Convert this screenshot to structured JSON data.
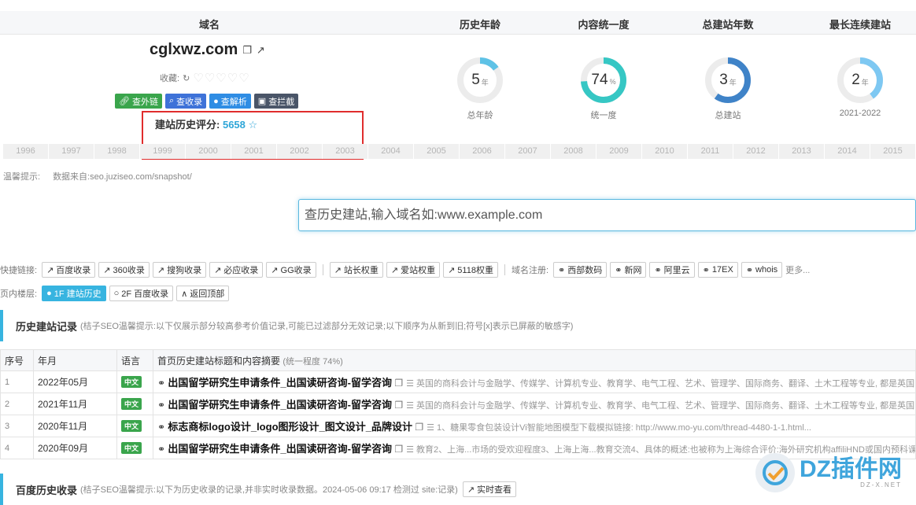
{
  "header": {
    "domain_col": "域名",
    "age_col": "历史年龄",
    "consistency_col": "内容统一度",
    "years_col": "总建站年数",
    "streak_col": "最长连续建站"
  },
  "domain": {
    "name": "cglxwz.com",
    "copy_icon": "copy-icon",
    "open_icon": "external-link-icon",
    "fav_label": "收藏:",
    "refresh_icon": "refresh-icon",
    "hearts": "♡♡♡♡♡"
  },
  "actions": [
    {
      "label": "查外链",
      "icon": "link-icon",
      "color": "#3aa54c"
    },
    {
      "label": "查收录",
      "icon": "search-icon",
      "color": "#3e72d8"
    },
    {
      "label": "查解析",
      "icon": "location-icon",
      "color": "#2f8de4"
    },
    {
      "label": "查拦截",
      "icon": "lock-icon",
      "color": "#4a5568"
    }
  ],
  "score": {
    "label": "建站历史评分:",
    "value": "5658",
    "star": "☆"
  },
  "stats": [
    {
      "value": "5",
      "unit": "年",
      "label": "总年龄",
      "fraction": 0.15,
      "color": "#5ec2e6"
    },
    {
      "value": "74",
      "unit": "%",
      "label": "统一度",
      "fraction": 0.74,
      "color": "#36c7c4"
    },
    {
      "value": "3",
      "unit": "年",
      "label": "总建站",
      "fraction": 0.6,
      "color": "#3f83c8"
    },
    {
      "value": "2",
      "unit": "年",
      "label": "2021-2022",
      "fraction": 0.4,
      "color": "#7ec8f2"
    }
  ],
  "timeline": [
    "1996",
    "1997",
    "1998",
    "1999",
    "2000",
    "2001",
    "2002",
    "2003",
    "2004",
    "2005",
    "2006",
    "2007",
    "2008",
    "2009",
    "2010",
    "2011",
    "2012",
    "2013",
    "2014",
    "2015"
  ],
  "tip": {
    "label": "温馨提示:",
    "source": "数据来自:seo.juziseo.com/snapshot/"
  },
  "search": {
    "placeholder": "查历史建站,输入域名如:www.example.com"
  },
  "quick_links": {
    "label": "快捷链接:",
    "group1": [
      "百度收录",
      "360收录",
      "搜狗收录",
      "必应收录",
      "GG收录"
    ],
    "group2": [
      "站长权重",
      "爱站权重",
      "5118权重"
    ],
    "register_label": "域名注册:",
    "group3": [
      "西部数码",
      "新网",
      "阿里云",
      "17EX",
      "whois"
    ],
    "more": "更多..."
  },
  "floors": {
    "label": "页内楼层:",
    "items": [
      "1F 建站历史",
      "2F 百度收录",
      "返回顶部"
    ]
  },
  "history": {
    "title": "历史建站记录",
    "desc": "(桔子SEO温馨提示:以下仅展示部分较高参考价值记录,可能已过滤部分无效记录;以下顺序为从新到旧;符号[x]表示已屏蔽的敏感字)",
    "cols": {
      "idx": "序号",
      "date": "年月",
      "lang": "语言",
      "title": "首页历史建站标题和内容摘要",
      "title_note": "(统一程度 74%)"
    },
    "rows": [
      {
        "idx": "1",
        "date": "2022年05月",
        "lang": "中文",
        "title": "出国留学研究生申请条件_出国读研咨询-留学咨询",
        "desc": "英国的商科会计与金融学、传媒学、计算机专业、教育学、电气工程、艺术、管理学、国际商务、翻译、土木工程等专业, 都是英国的强"
      },
      {
        "idx": "2",
        "date": "2021年11月",
        "lang": "中文",
        "title": "出国留学研究生申请条件_出国读研咨询-留学咨询",
        "desc": "英国的商科会计与金融学、传媒学、计算机专业、教育学、电气工程、艺术、管理学、国际商务、翻译、土木工程等专业, 都是英国的强"
      },
      {
        "idx": "3",
        "date": "2020年11月",
        "lang": "中文",
        "title": "标志商标logo设计_logo图形设计_图文设计_品牌设计",
        "desc": "1、糖果零食包装设计Vi智能地图模型下载模拟链接: http://www.mo-yu.com/thread-4480-1-1.html..."
      },
      {
        "idx": "4",
        "date": "2020年09月",
        "lang": "中文",
        "title": "出国留学研究生申请条件_出国读研咨询-留学咨询",
        "desc": "教育2、上海...市场的受欢迎程度3、上海上海...教育交流4、具体的概述:也被称为上海综合评价:海外研究机构affiliHND或国内预科课程"
      }
    ]
  },
  "baidu": {
    "title": "百度历史收录",
    "desc": "(桔子SEO温馨提示:以下为历史收录的记录,并非实时收录数据。2024-05-06 09:17 检测过 site:记录)",
    "button": "实时查看"
  },
  "watermark": {
    "text": "DZ插件网",
    "sub": "DZ-X.NET"
  }
}
